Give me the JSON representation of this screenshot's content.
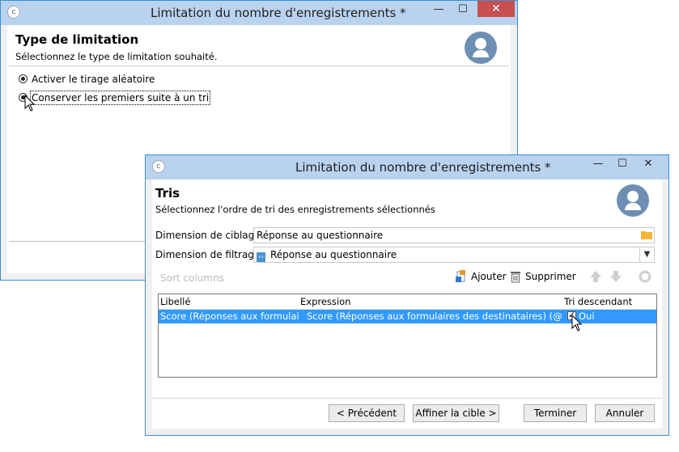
{
  "back_window": {
    "title": "Limitation du nombre d'enregistrements *",
    "minimize": "—",
    "maximize": "☐",
    "close": "✕",
    "header_title": "Type de limitation",
    "header_subtitle": "Sélectionnez le type de limitation souhaité.",
    "options": [
      {
        "label": "Activer le tirage aléatoire",
        "selected": false
      },
      {
        "label": "Conserver les premiers suite à un tri",
        "selected": true
      }
    ]
  },
  "front_window": {
    "title": "Limitation du nombre d'enregistrements *",
    "minimize": "—",
    "maximize": "☐",
    "close": "✕",
    "header_title": "Tris",
    "header_subtitle": "Sélectionnez l'ordre de tri des enregistrements sélectionnés",
    "targeting_label": "Dimension de ciblage :",
    "targeting_value": "Réponse au questionnaire",
    "filtering_label": "Dimension de filtrage :",
    "filtering_value": "Réponse au questionnaire",
    "toolbar": {
      "grid_title": "Sort columns",
      "add": "Ajouter",
      "delete": "Supprimer"
    },
    "grid": {
      "columns": [
        "Libellé",
        "Expression",
        "Tri descendant"
      ],
      "rows": [
        {
          "label": "Score (Réponses aux formulair...",
          "expression": "Score (Réponses aux formulaires des destinataires) (@score)",
          "descending": "Oui"
        }
      ]
    },
    "buttons": {
      "previous": "< Précédent",
      "refine": "Affiner la cible >",
      "finish": "Terminer",
      "cancel": "Annuler"
    }
  },
  "colors": {
    "titlebar": "#b9d3ef",
    "window_border": "#3c8fd6",
    "selection": "#3399ff",
    "close_button": "#c75050"
  }
}
